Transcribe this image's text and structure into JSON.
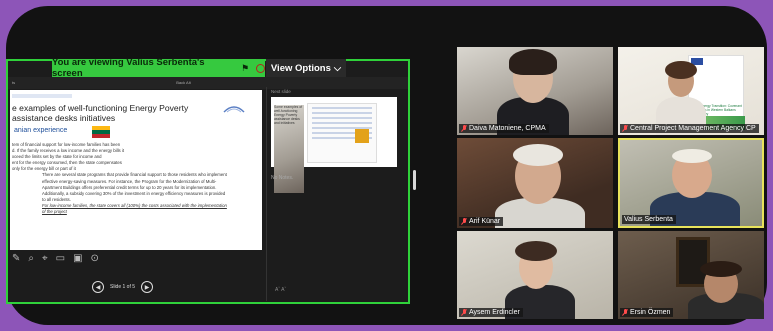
{
  "meeting": {
    "share_banner": "You are viewing  Valius Serbenta's screen",
    "view_options": "View Options"
  },
  "ppt": {
    "topline_left": "ts",
    "topline_right": "Back Alt",
    "next_slide_label": "Next slide",
    "notes": "No Notes.",
    "slide_counter": "Slide 1 of 5",
    "notes_foot": "Aˇ  Aˇ"
  },
  "slide": {
    "title": "e examples of well-functioning Energy Poverty assistance desks initiatives",
    "subtitle": "anian experience",
    "body": [
      "tem of financial support for low-income families has been",
      "d. If the family receives a low income and the energy bills it",
      "xceed the limits set by the state for income and",
      "ent for the energy consumed, then the state compensates",
      "only for the energy bill or part of it"
    ],
    "body_indent": [
      "There are several state programs that provide financial support to those residents who implement",
      "effective energy-saving measures. For instance, the Program for the Modernization of Multi-",
      "Apartment Buildings offers preferential credit terms for up to 20 years for its implementation.",
      "Additionally, a subsidy covering 30% of the investment in energy efficiency measures is provided",
      "to all residents."
    ],
    "body_underline": [
      "For low-income families, the state covers all (100%) the costs associated with the implementation",
      "of the project"
    ]
  },
  "next_thumb": {
    "text": "Some examples of well-functioning Energy Poverty assistance desks and initiatives"
  },
  "participants": [
    {
      "name": "Daiva Matoniene, CPMA"
    },
    {
      "name": "Central Project Management Agency CP"
    },
    {
      "name": "Arif Künar"
    },
    {
      "name": "Valius Serbenta"
    },
    {
      "name": "Aysem Erdincler"
    },
    {
      "name": "Ersin Özmen"
    }
  ],
  "poster": {
    "text": "EU 4 Energy Transition: Covenant of Mayors in Western Balkans and Turkey"
  },
  "colors": {
    "frame": "#8d55b8",
    "share_green": "#36c93f",
    "active_speaker": "#e8e35b",
    "muted_red": "#ff4b4b"
  }
}
